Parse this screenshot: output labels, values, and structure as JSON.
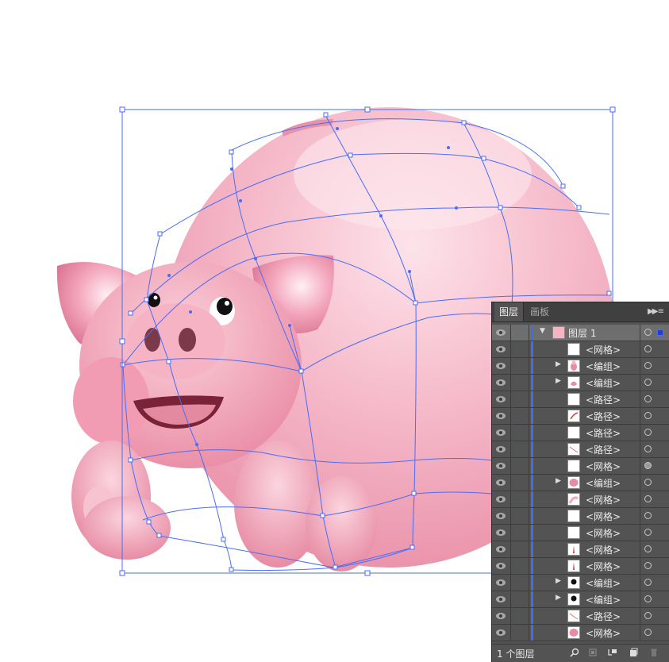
{
  "canvas": {
    "pig_body_color": "#f4b4c4",
    "mesh_color": "#4a6cf7"
  },
  "layers_panel": {
    "tabs": [
      "图层",
      "画板"
    ],
    "panel_menu_icon": "double-arrow-menu-icon",
    "parent_layer": {
      "name": "图层 1",
      "expanded": true
    },
    "rows": [
      {
        "label": "<网格>",
        "expandable": false,
        "thumb": "plain"
      },
      {
        "label": "<编组>",
        "expandable": true,
        "thumb": "pig-figure"
      },
      {
        "label": "<编组>",
        "expandable": true,
        "thumb": "pink-swirl"
      },
      {
        "label": "<路径>",
        "expandable": false,
        "thumb": "plain"
      },
      {
        "label": "<路径>",
        "expandable": false,
        "thumb": "red-stroke"
      },
      {
        "label": "<路径>",
        "expandable": false,
        "thumb": "plain"
      },
      {
        "label": "<路径>",
        "expandable": false,
        "thumb": "thin-curve"
      },
      {
        "label": "<网格>",
        "expandable": false,
        "thumb": "plain"
      },
      {
        "label": "<编组>",
        "expandable": true,
        "thumb": "pink-blob"
      },
      {
        "label": "<网格>",
        "expandable": false,
        "thumb": "pink-light"
      },
      {
        "label": "<网格>",
        "expandable": false,
        "thumb": "plain"
      },
      {
        "label": "<网格>",
        "expandable": false,
        "thumb": "plain"
      },
      {
        "label": "<网格>",
        "expandable": false,
        "thumb": "red-sliver"
      },
      {
        "label": "<网格>",
        "expandable": false,
        "thumb": "red-sliver"
      },
      {
        "label": "<编组>",
        "expandable": true,
        "thumb": "black-eye"
      },
      {
        "label": "<编组>",
        "expandable": true,
        "thumb": "black-eye"
      },
      {
        "label": "<路径>",
        "expandable": false,
        "thumb": "thin-curve"
      },
      {
        "label": "<网格>",
        "expandable": false,
        "thumb": "pink-blob"
      }
    ],
    "filled_circle_row": 7,
    "footer": {
      "count_label": "1 个图层",
      "icons": [
        "search-icon",
        "clip-mask-icon",
        "sublayer-icon",
        "new-layer-icon",
        "trash-icon"
      ]
    }
  }
}
